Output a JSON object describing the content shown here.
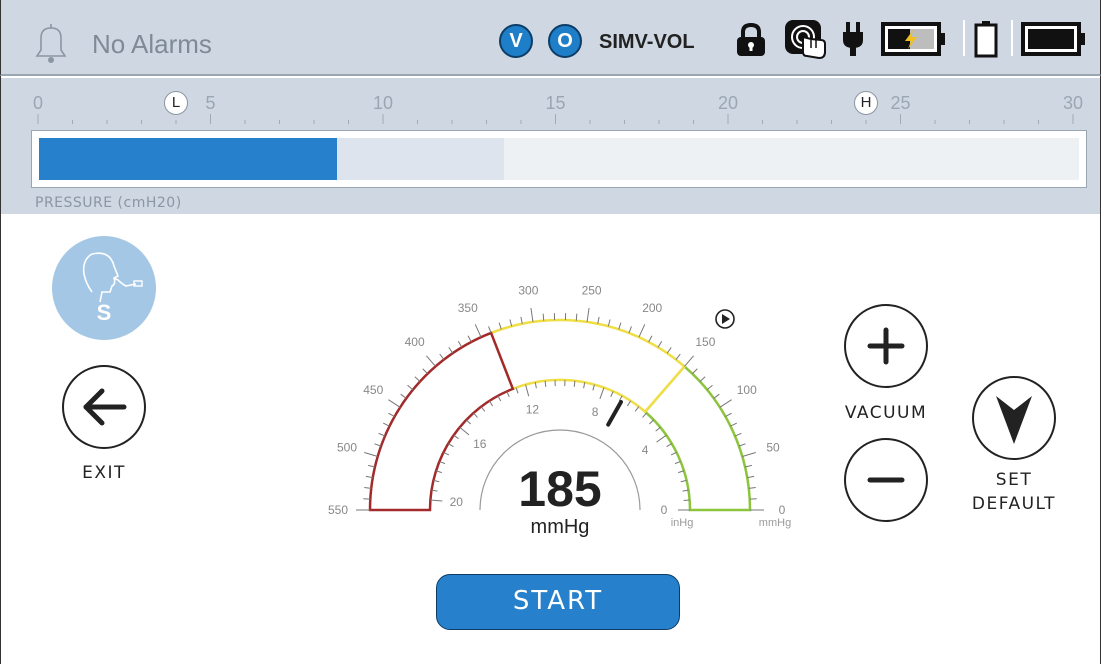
{
  "status_bar": {
    "alarm_text": "No Alarms",
    "mode_v": "V",
    "mode_o": "O",
    "vent_mode": "SIMV-VOL"
  },
  "pressure": {
    "ticks": [
      "0",
      "5",
      "10",
      "15",
      "20",
      "25",
      "30"
    ],
    "scale_min": 0,
    "scale_max": 30,
    "low_marker": "L",
    "low_marker_value": 4,
    "high_marker": "H",
    "high_marker_value": 24,
    "current_value": 8.6,
    "peak_value": 13.4,
    "label": "PRESSURE (cmH20)"
  },
  "suction": {
    "badge": "S"
  },
  "exit": {
    "label": "EXIT"
  },
  "gauge": {
    "value": "185",
    "unit": "mmHg",
    "mmhg_ticks": [
      "550",
      "500",
      "450",
      "400",
      "350",
      "300",
      "250",
      "200",
      "150",
      "100",
      "50",
      "0"
    ],
    "inhg_ticks": [
      "20",
      "16",
      "12",
      "8",
      "4",
      "0"
    ],
    "inhg_unit": "inHg",
    "mmhg_unit": "mmHg",
    "needle_value_mmhg": 185
  },
  "vacuum": {
    "label": "VACUUM"
  },
  "set_default": {
    "label_line1": "SET",
    "label_line2": "DEFAULT"
  },
  "start": {
    "label": "START"
  },
  "colors": {
    "accent_blue": "#2680cb",
    "zone_red": "#a32a2a",
    "zone_yellow": "#f0de45",
    "zone_green": "#8cc43c"
  }
}
